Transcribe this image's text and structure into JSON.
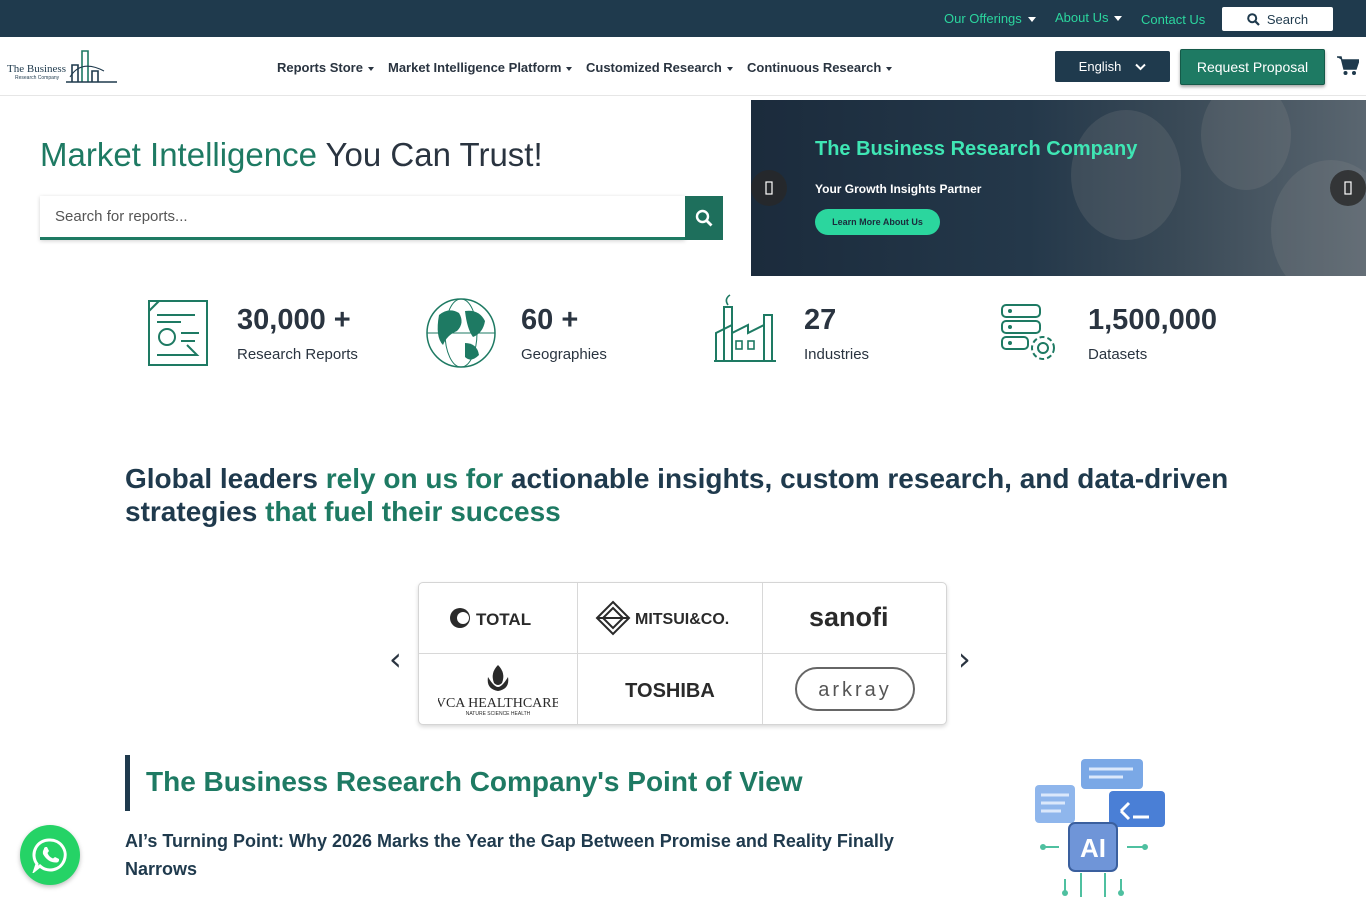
{
  "topbar": {
    "offerings": "Our Offerings",
    "about": "About Us",
    "contact": "Contact Us",
    "search": "Search"
  },
  "navbar": {
    "logo_line1": "The Business",
    "logo_line2": "Research Company",
    "items": [
      {
        "label": "Reports Store"
      },
      {
        "label": "Market Intelligence Platform"
      },
      {
        "label": "Customized Research"
      },
      {
        "label": "Continuous Research"
      }
    ],
    "language": "English",
    "proposal": "Request Proposal"
  },
  "hero": {
    "title_accent": "Market Intelligence",
    "title_rest": " You Can Trust!",
    "search_placeholder": "Search for reports..."
  },
  "banner": {
    "title": "The Business Research Company",
    "subtitle": "Your Growth Insights Partner",
    "button": "Learn More About Us",
    "prev_icon": "",
    "next_icon": ""
  },
  "stats": [
    {
      "value": "30,000 +",
      "label": "Research Reports"
    },
    {
      "value": "60 +",
      "label": "Geographies"
    },
    {
      "value": "27",
      "label": "Industries"
    },
    {
      "value": "1,500,000",
      "label": "Datasets"
    }
  ],
  "leaders": {
    "p1": "Global leaders ",
    "p2": "rely on us for",
    "p3": " actionable insights, custom research, and data-driven strategies ",
    "p4": "that fuel their success"
  },
  "clients": {
    "prev": "‹",
    "next": "›",
    "logos": [
      "TOTAL",
      "MITSUI&CO.",
      "sanofi",
      "VCA HEALTHCARE",
      "TOSHIBA",
      "arkray"
    ],
    "vca_tagline": "NATURE SCIENCE HEALTH"
  },
  "pov": {
    "title": "The Business Research Company's Point of View",
    "article": "AI’s Turning Point: Why 2026 Marks the Year the Gap Between Promise and Reality Finally Narrows",
    "ai_label": "AI"
  },
  "colors": {
    "primary": "#1e7a63",
    "dark": "#1f3a4d",
    "mint": "#2bd69e",
    "whatsapp": "#25d366"
  }
}
